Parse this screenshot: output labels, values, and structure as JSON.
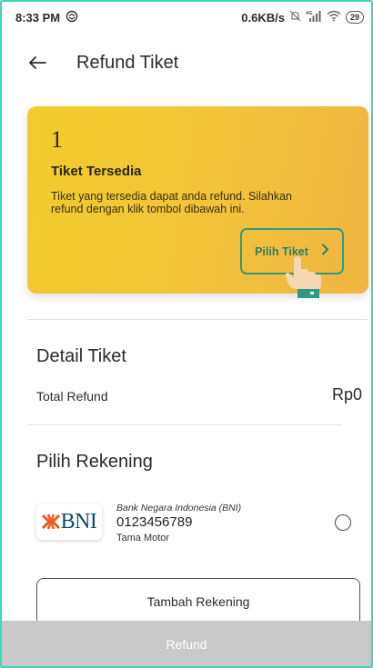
{
  "status_bar": {
    "time": "8:33 PM",
    "net_speed": "0.6KB/s",
    "battery": "29",
    "icons": [
      "sync-icon",
      "alarm-off-icon",
      "signal-4g-icon",
      "wifi-icon",
      "battery-icon"
    ]
  },
  "header": {
    "title": "Refund Tiket"
  },
  "ticket_card": {
    "count": "1",
    "heading": "Tiket Tersedia",
    "description": "Tiket yang tersedia dapat anda refund. Silahkan refund dengan klik tombol dibawah ini.",
    "button_label": "Pilih Tiket",
    "gradient_colors": [
      "#f1cc2a",
      "#efb541"
    ]
  },
  "detail": {
    "title": "Detail Tiket",
    "total_label": "Total Refund",
    "total_value": "Rp0"
  },
  "rekening": {
    "title": "Pilih Rekening",
    "bank": {
      "logo_text": "BNI",
      "name": "Bank Negara Indonesia (BNI)",
      "account_number": "0123456789",
      "holder": "Tama Motor",
      "selected": false
    },
    "add_button_label": "Tambah Rekening"
  },
  "footer": {
    "refund_label": "Refund",
    "disabled_color": "#c9c9c9"
  },
  "colors": {
    "accent": "#2e9a82",
    "frame": "#3fd6b8"
  }
}
